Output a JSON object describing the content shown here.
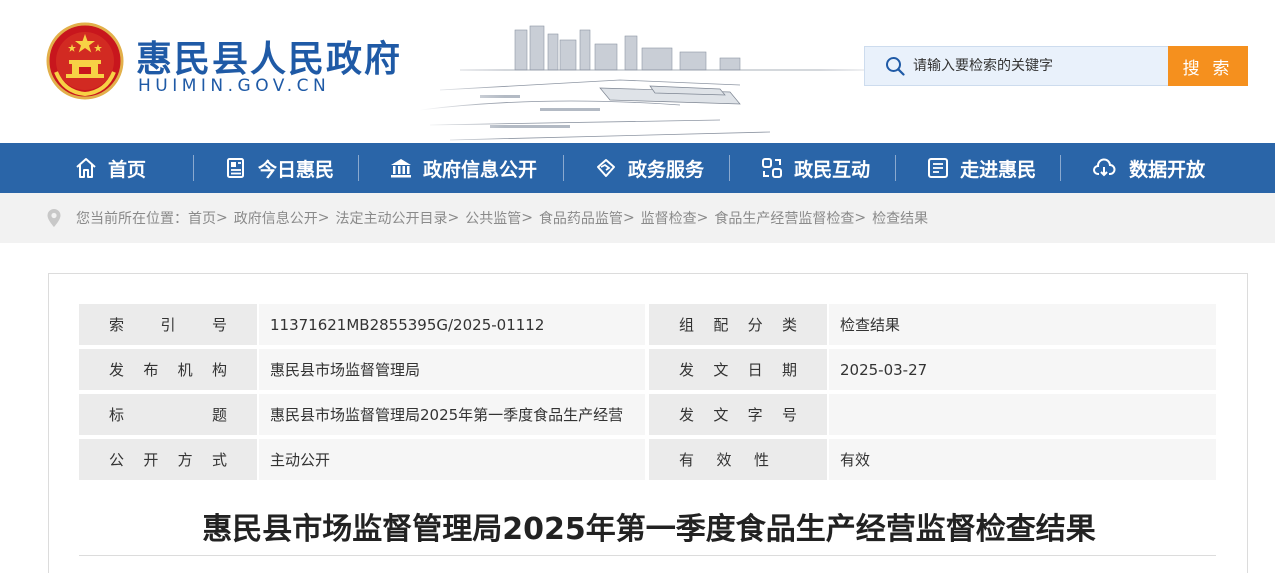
{
  "header": {
    "site_title": "惠民县人民政府",
    "site_domain": "HUIMIN.GOV.CN",
    "brand_color": "#1f5aa6",
    "search": {
      "placeholder": "请输入要检索的关键字",
      "button_label": "搜 索",
      "button_color": "#f5901e"
    }
  },
  "nav": {
    "background": "#2a65a8",
    "items": [
      {
        "label": "首页",
        "icon": "home-icon"
      },
      {
        "label": "今日惠民",
        "icon": "news-icon"
      },
      {
        "label": "政府信息公开",
        "icon": "government-building-icon"
      },
      {
        "label": "政务服务",
        "icon": "handshake-icon"
      },
      {
        "label": "政民互动",
        "icon": "interaction-icon"
      },
      {
        "label": "走进惠民",
        "icon": "book-icon"
      },
      {
        "label": "数据开放",
        "icon": "cloud-download-icon"
      }
    ]
  },
  "breadcrumb": {
    "prefix": "您当前所在位置：",
    "items": [
      "首页",
      "政府信息公开",
      "法定主动公开目录",
      "公共监管",
      "食品药品监管",
      "监督检查",
      "食品生产经营监督检查",
      "检查结果"
    ],
    "separator": ">"
  },
  "meta": {
    "rows": [
      {
        "left_label": [
          "索",
          "引",
          "号"
        ],
        "left_value": "11371621MB2855395G/2025-01112",
        "right_label": [
          "组",
          "配",
          "分",
          "类"
        ],
        "right_value": "检查结果"
      },
      {
        "left_label": [
          "发",
          "布",
          "机",
          "构"
        ],
        "left_value": "惠民县市场监督管理局",
        "right_label": [
          "发",
          "文",
          "日",
          "期"
        ],
        "right_value": "2025-03-27"
      },
      {
        "left_label": [
          "标",
          "题"
        ],
        "left_value": "惠民县市场监督管理局2025年第一季度食品生产经营",
        "right_label": [
          "发",
          "文",
          "字",
          "号"
        ],
        "right_value": ""
      },
      {
        "left_label": [
          "公",
          "开",
          "方",
          "式"
        ],
        "left_value": "主动公开",
        "right_label": [
          "有",
          "效",
          "性"
        ],
        "right_value": "有效"
      }
    ]
  },
  "document": {
    "title": "惠民县市场监督管理局2025年第一季度食品生产经营监督检查结果"
  }
}
